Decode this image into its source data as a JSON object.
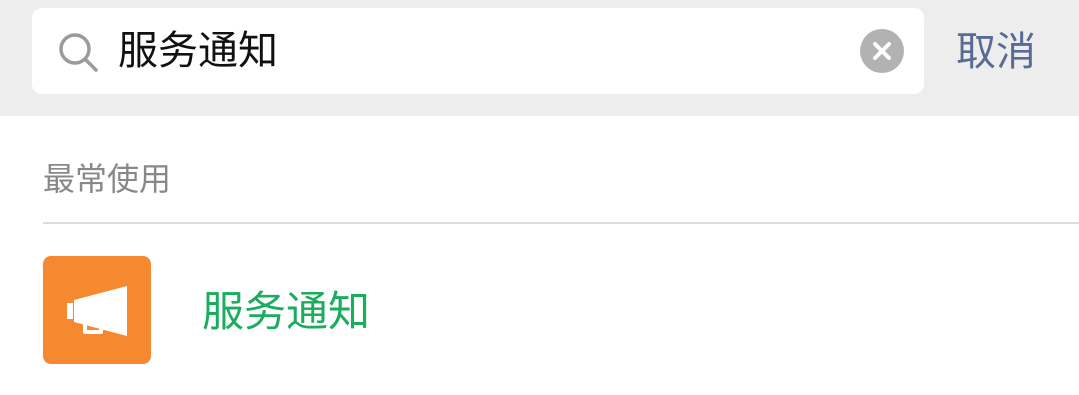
{
  "search": {
    "query": "服务通知",
    "cancel_label": "取消"
  },
  "section": {
    "title": "最常使用"
  },
  "results": [
    {
      "label": "服务通知",
      "icon": "megaphone-icon",
      "icon_bg": "#f6882f",
      "label_color": "#1aad5e"
    }
  ],
  "colors": {
    "search_bar_bg": "#ededed",
    "cancel_text": "#576b95",
    "clear_button": "#b2b2b2"
  }
}
